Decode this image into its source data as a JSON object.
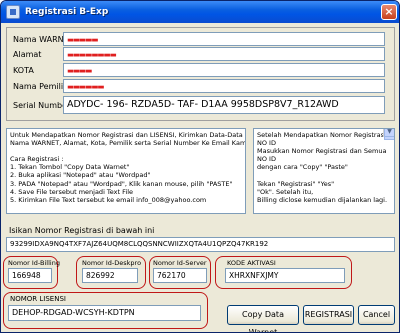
{
  "window": {
    "title": "Registrasi B-Exp",
    "close_label": "×"
  },
  "info": {
    "nama_warnet_label": "Nama WARNET",
    "alamat_label": "Alamat",
    "kota_label": "KOTA",
    "nama_pemilik_label": "Nama Pemilik",
    "serial_label": "Serial Number",
    "serial_value": "ADYDC- 196- RZDA5D- TAF- D1AA 9958DSP8V7_R12AWD"
  },
  "instructions": {
    "lines": [
      "Untuk Mendapatkan Nomor Registrasi dan LISENSI, Kirimkan Data-Data",
      "Nama WARNET, Alamat, Kota, Pemilik serta Serial Number Ke Email Kami.",
      "",
      "Cara Registrasi :",
      "1. Tekan Tombol \"Copy Data Warnet\"",
      "2. Buka aplikasi \"Notepad\" atau \"Wordpad\"",
      "3. PADA \"Notepad\" atau \"Wordpad\", Klik kanan mouse, pilih \"PASTE\"",
      "4. Save File tersebut menjadi Text File",
      "5. Kirimkan File Text tersebut ke email info_008@yahoo.com"
    ]
  },
  "side_note": {
    "lines": [
      "Setelah Mendapatkan Nomor Registrasi &",
      "NO ID",
      "Masukkan Nomor Registrasi dan Semua",
      "NO ID",
      "dengan cara \"Copy\" \"Paste\"",
      "",
      "Tekan \"Registrasi\" \"Yes\"",
      "\"Ok\". Setelah itu,",
      "Billing diclose kemudian dijalankan lagi."
    ]
  },
  "registration": {
    "label": "Isikan Nomor Registrasi di bawah ini",
    "value": "93299IDXA9NQ4TXF7AJZ64UQM8CLQQSNNCWIIZXQTA4U1QPZQ47KR192"
  },
  "ids": {
    "billing_label": "Nomor Id-Billing",
    "billing_value": "166948",
    "deskpro_label": "Nomor Id-Deskpro",
    "deskpro_value": "826992",
    "server_label": "Nomor Id-Server",
    "server_value": "762170",
    "kode_label": "KODE AKTIVASI",
    "kode_value": "XHRXNFXJMY"
  },
  "license": {
    "label": "NOMOR LISENSI",
    "value": "DEHOP-RDGAD-WCSYH-KDTPN"
  },
  "buttons": {
    "copy": "Copy Data Warnet",
    "registrasi": "REGISTRASI",
    "cancel": "Cancel"
  },
  "colors": {
    "annotation": "#c01818",
    "titlebar": "#0055e5"
  }
}
